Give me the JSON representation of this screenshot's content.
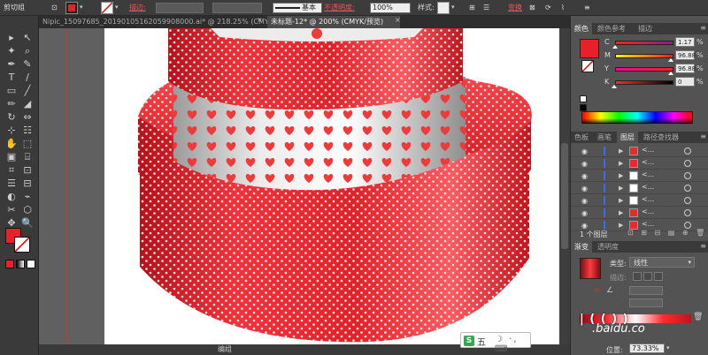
{
  "control_bar": {
    "group_label": "剪切组",
    "stroke_label": "描边:",
    "brush_label": "基本",
    "opacity_label": "不透明度:",
    "opacity_value": "100%",
    "style_label": "样式:",
    "transform_label": "变换"
  },
  "tabs": [
    {
      "label": "Nipic_15097685_20190105162059908000.ai* @ 218.25% (CMYK/预览)",
      "close": "×"
    },
    {
      "label": "未标题-12* @ 200% (CMYK/预览)",
      "close": "×"
    }
  ],
  "tools": [
    "▸",
    "↖",
    "✦",
    "⌕",
    "✒",
    "✎",
    "T",
    "∕",
    "▭",
    "╱",
    "✏",
    "◢",
    "↻",
    "⇔",
    "⊹",
    "☷",
    "✋",
    "⬚",
    "▣",
    "⌸",
    "⌗",
    "⊡",
    "☰",
    "⊟",
    "◐",
    "⌁",
    "✂",
    "⬡",
    "✥",
    "🔍"
  ],
  "canvas": {
    "status_text": "编组"
  },
  "ime": {
    "text": "五",
    "icons": "☽ ·, ⌨"
  },
  "color_panel": {
    "tabs": [
      "颜色",
      "颜色参考",
      "描边"
    ],
    "channels": [
      {
        "label": "C",
        "value": "1.17",
        "unit": "%",
        "level": 0.0117
      },
      {
        "label": "M",
        "value": "96.88",
        "unit": "%",
        "level": 0.9688
      },
      {
        "label": "Y",
        "value": "96.88",
        "unit": "%",
        "level": 0.9688
      },
      {
        "label": "K",
        "value": "0",
        "unit": "%",
        "level": 0.0
      }
    ],
    "fill_color": "#e8202a"
  },
  "layers_panel": {
    "tabs": [
      "色板",
      "画笔",
      "图层",
      "路径查找器"
    ],
    "rows": [
      {
        "name": "<...",
        "thumb_color": "#e82a2a"
      },
      {
        "name": "<...",
        "thumb_color": "#e82a2a"
      },
      {
        "name": "<...",
        "thumb_color": "#ffffff"
      },
      {
        "name": "<...",
        "thumb_color": "#ffffff"
      },
      {
        "name": "<...",
        "thumb_color": "#ffffff"
      },
      {
        "name": "<...",
        "thumb_color": "#e82a2a"
      },
      {
        "name": "<...",
        "thumb_color": "#e82a2a"
      }
    ],
    "footer": "1 个图层"
  },
  "gradient_panel": {
    "tabs": [
      "渐变",
      "透明度"
    ],
    "type_label": "类型:",
    "type_value": "线性",
    "stroke_label": "描边:",
    "position_label": "位置:",
    "position_value": "73.33%"
  },
  "watermark": {
    "text": ".baidu.co"
  },
  "colors": {
    "accent_red": "#e8202a",
    "ui_dark": "#3a3a3a",
    "panel_bg": "#535353",
    "canvas_bg": "#ffffff"
  }
}
